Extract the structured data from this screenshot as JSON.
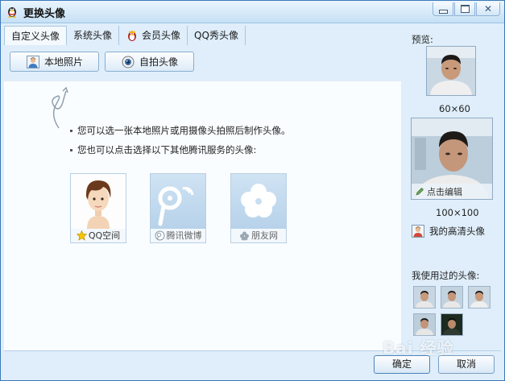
{
  "window": {
    "title": "更换头像"
  },
  "tabs": [
    {
      "label": "自定义头像",
      "active": true
    },
    {
      "label": "系统头像"
    },
    {
      "label": "会员头像",
      "icon": "vip-penguin-icon"
    },
    {
      "label": "QQ秀头像"
    }
  ],
  "toolbar": {
    "local_photo": "本地照片",
    "webcam": "自拍头像"
  },
  "tips": {
    "line1": "您可以选一张本地照片或用摄像头拍照后制作头像。",
    "line2": "您也可以点击选择以下其他腾讯服务的头像:"
  },
  "services": [
    {
      "label": "QQ空间",
      "icon": "qzone-star-icon",
      "enabled": true
    },
    {
      "label": "腾讯微博",
      "icon": "weibo-icon",
      "enabled": false
    },
    {
      "label": "朋友网",
      "icon": "pengyou-icon",
      "enabled": false
    }
  ],
  "preview": {
    "label": "预览:",
    "size_small": "60×60",
    "size_large": "100×100",
    "edit_label": "点击编辑"
  },
  "hd_avatar_label": "我的高清头像",
  "history": {
    "label": "我使用过的头像:",
    "count": 5
  },
  "footer": {
    "ok": "确定",
    "cancel": "取消"
  },
  "watermark": "Bai 经验",
  "colors": {
    "accent": "#3b78b8",
    "window_bg": "#dfeefa",
    "panel_bg": "#fafdff"
  }
}
